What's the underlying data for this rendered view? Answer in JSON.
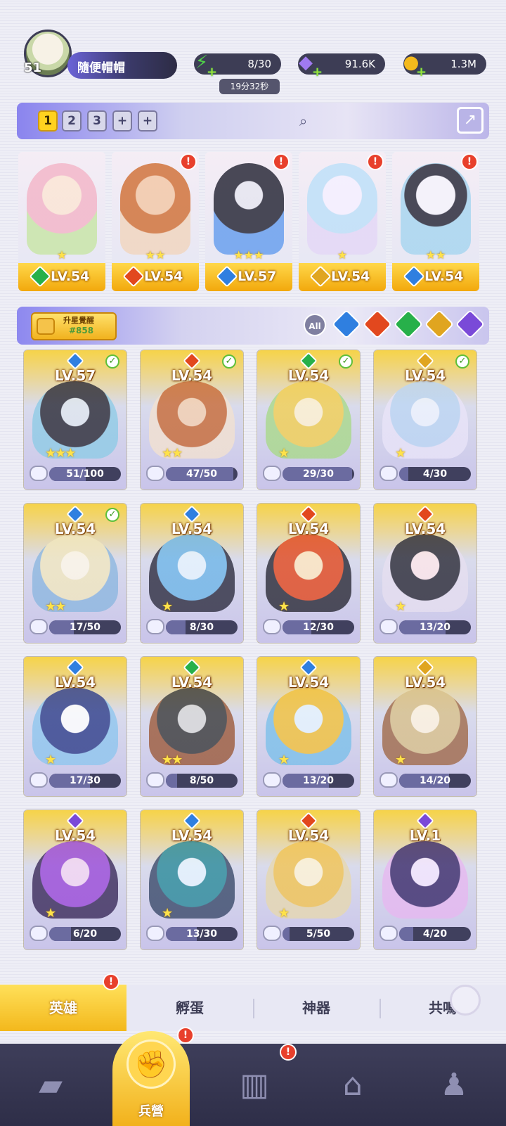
{
  "player": {
    "level": "51",
    "name": "隨便帽帽"
  },
  "resources": {
    "energy": {
      "value": "8/30",
      "timer": "19分32秒",
      "icon": "lightning-icon"
    },
    "gems": {
      "value": "91.6K",
      "icon": "gem-icon"
    },
    "coins": {
      "value": "1.3M",
      "icon": "coin-icon"
    }
  },
  "team_tabs": [
    "1",
    "2",
    "3",
    "+",
    "+"
  ],
  "team_slots": [
    {
      "level": "LV.54",
      "stars": "★",
      "element": "#27b04a"
    },
    {
      "level": "LV.54",
      "stars": "★★",
      "element": "#e2481e"
    },
    {
      "level": "LV.57",
      "stars": "★★★",
      "element": "#2f7fe0"
    },
    {
      "level": "LV.54",
      "stars": "★",
      "element": "#e0a520"
    },
    {
      "level": "LV.54",
      "stars": "★★",
      "element": "#2f7fe0"
    }
  ],
  "awaken": {
    "label": "升星覺醒",
    "code": "#858"
  },
  "filters": {
    "all_label": "All",
    "colors": [
      "#2f7fe0",
      "#e2481e",
      "#27b04a",
      "#e0a520",
      "#7a4ad8"
    ]
  },
  "heroes": [
    {
      "level": "LV.57",
      "progress": "51/100",
      "fill": 0.51,
      "stars": "★★★",
      "element": "#2f7fe0",
      "check": true
    },
    {
      "level": "LV.54",
      "progress": "47/50",
      "fill": 0.94,
      "stars": "★★",
      "element": "#e2481e",
      "check": true
    },
    {
      "level": "LV.54",
      "progress": "29/30",
      "fill": 0.97,
      "stars": "★",
      "element": "#27b04a",
      "check": true
    },
    {
      "level": "LV.54",
      "progress": "4/30",
      "fill": 0.13,
      "stars": "★",
      "element": "#e0a520",
      "check": true
    },
    {
      "level": "LV.54",
      "progress": "17/50",
      "fill": 0.34,
      "stars": "★★",
      "element": "#2f7fe0",
      "check": true
    },
    {
      "level": "LV.54",
      "progress": "8/30",
      "fill": 0.27,
      "stars": "★",
      "element": "#2f7fe0",
      "check": false
    },
    {
      "level": "LV.54",
      "progress": "12/30",
      "fill": 0.4,
      "stars": "★",
      "element": "#e2481e",
      "check": false
    },
    {
      "level": "LV.54",
      "progress": "13/20",
      "fill": 0.65,
      "stars": "★",
      "element": "#e2481e",
      "check": false
    },
    {
      "level": "LV.54",
      "progress": "17/30",
      "fill": 0.57,
      "stars": "★",
      "element": "#2f7fe0",
      "check": false
    },
    {
      "level": "LV.54",
      "progress": "8/50",
      "fill": 0.16,
      "stars": "★★",
      "element": "#27b04a",
      "check": false
    },
    {
      "level": "LV.54",
      "progress": "13/20",
      "fill": 0.65,
      "stars": "★",
      "element": "#2f7fe0",
      "check": false
    },
    {
      "level": "LV.54",
      "progress": "14/20",
      "fill": 0.7,
      "stars": "★",
      "element": "#e0a520",
      "check": false
    },
    {
      "level": "LV.54",
      "progress": "6/20",
      "fill": 0.3,
      "stars": "★",
      "element": "#7a4ad8",
      "check": false
    },
    {
      "level": "LV.54",
      "progress": "13/30",
      "fill": 0.43,
      "stars": "★",
      "element": "#2f7fe0",
      "check": false
    },
    {
      "level": "LV.54",
      "progress": "5/50",
      "fill": 0.1,
      "stars": "★",
      "element": "#e2481e",
      "check": false
    },
    {
      "level": "LV.1",
      "progress": "4/20",
      "fill": 0.2,
      "stars": "",
      "element": "#7a4ad8",
      "check": false
    }
  ],
  "sub_tabs": [
    "英雄",
    "孵蛋",
    "神器",
    "共鳴"
  ],
  "bottom_nav": {
    "active_label": "兵營",
    "items": [
      "cards-icon",
      "barracks-icon",
      "book-icon",
      "shrine-icon",
      "wizard-icon"
    ]
  },
  "badge": "!"
}
